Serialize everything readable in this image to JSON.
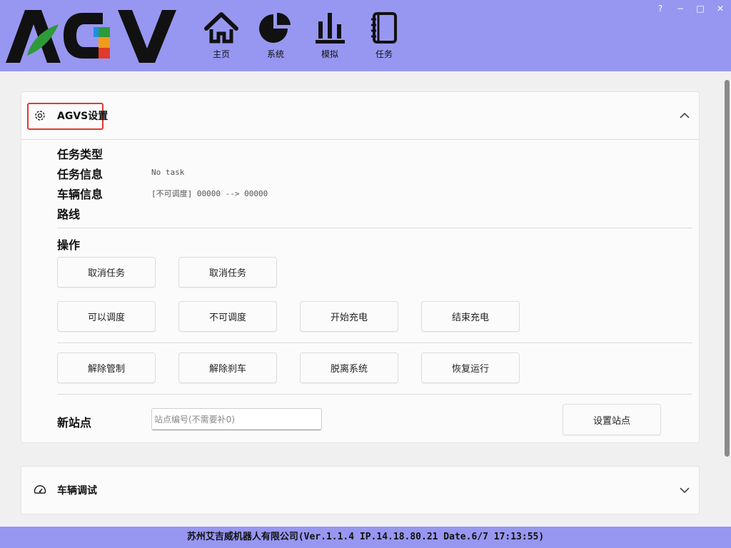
{
  "header": {
    "logo_text": "AGV",
    "nav": [
      {
        "icon": "home-icon",
        "label": "主页"
      },
      {
        "icon": "pie-chart-icon",
        "label": "系统"
      },
      {
        "icon": "bar-chart-icon",
        "label": "模拟"
      },
      {
        "icon": "notebook-icon",
        "label": "任务"
      }
    ],
    "window_controls": {
      "help": "?",
      "minimize": "−",
      "maximize": "□",
      "close": "✕"
    },
    "colors": {
      "bar": "#9797f2",
      "logo_dark": "#111111",
      "logo_leaf": "#2e9a3a",
      "logo_blue": "#1f8ee6",
      "logo_orange": "#f29b1a",
      "logo_red": "#e23a2a"
    }
  },
  "agvs_panel": {
    "icon": "gear-icon",
    "title": "AGVS设置",
    "expanded": true,
    "fields": [
      {
        "label": "任务类型",
        "value": ""
      },
      {
        "label": "任务信息",
        "value": "No task"
      },
      {
        "label": "车辆信息",
        "value": "[不可调度] 00000 --> 00000"
      },
      {
        "label": "路线",
        "value": ""
      }
    ],
    "operations_label": "操作",
    "buttons_row1": [
      "取消任务",
      "取消任务"
    ],
    "buttons_row2": [
      "可以调度",
      "不可调度",
      "开始充电",
      "结束充电"
    ],
    "buttons_row3": [
      "解除管制",
      "解除刹车",
      "脱离系统",
      "恢复运行"
    ],
    "new_station": {
      "label": "新站点",
      "placeholder": "站点编号(不需要补0)",
      "value": "",
      "button": "设置站点"
    }
  },
  "vehicle_panel": {
    "icon": "speedometer-icon",
    "title": "车辆调试",
    "expanded": false
  },
  "footer": {
    "text": "苏州艾吉威机器人有限公司(Ver.1.1.4 IP.14.18.80.21 Date.6/7 17:13:55)"
  }
}
